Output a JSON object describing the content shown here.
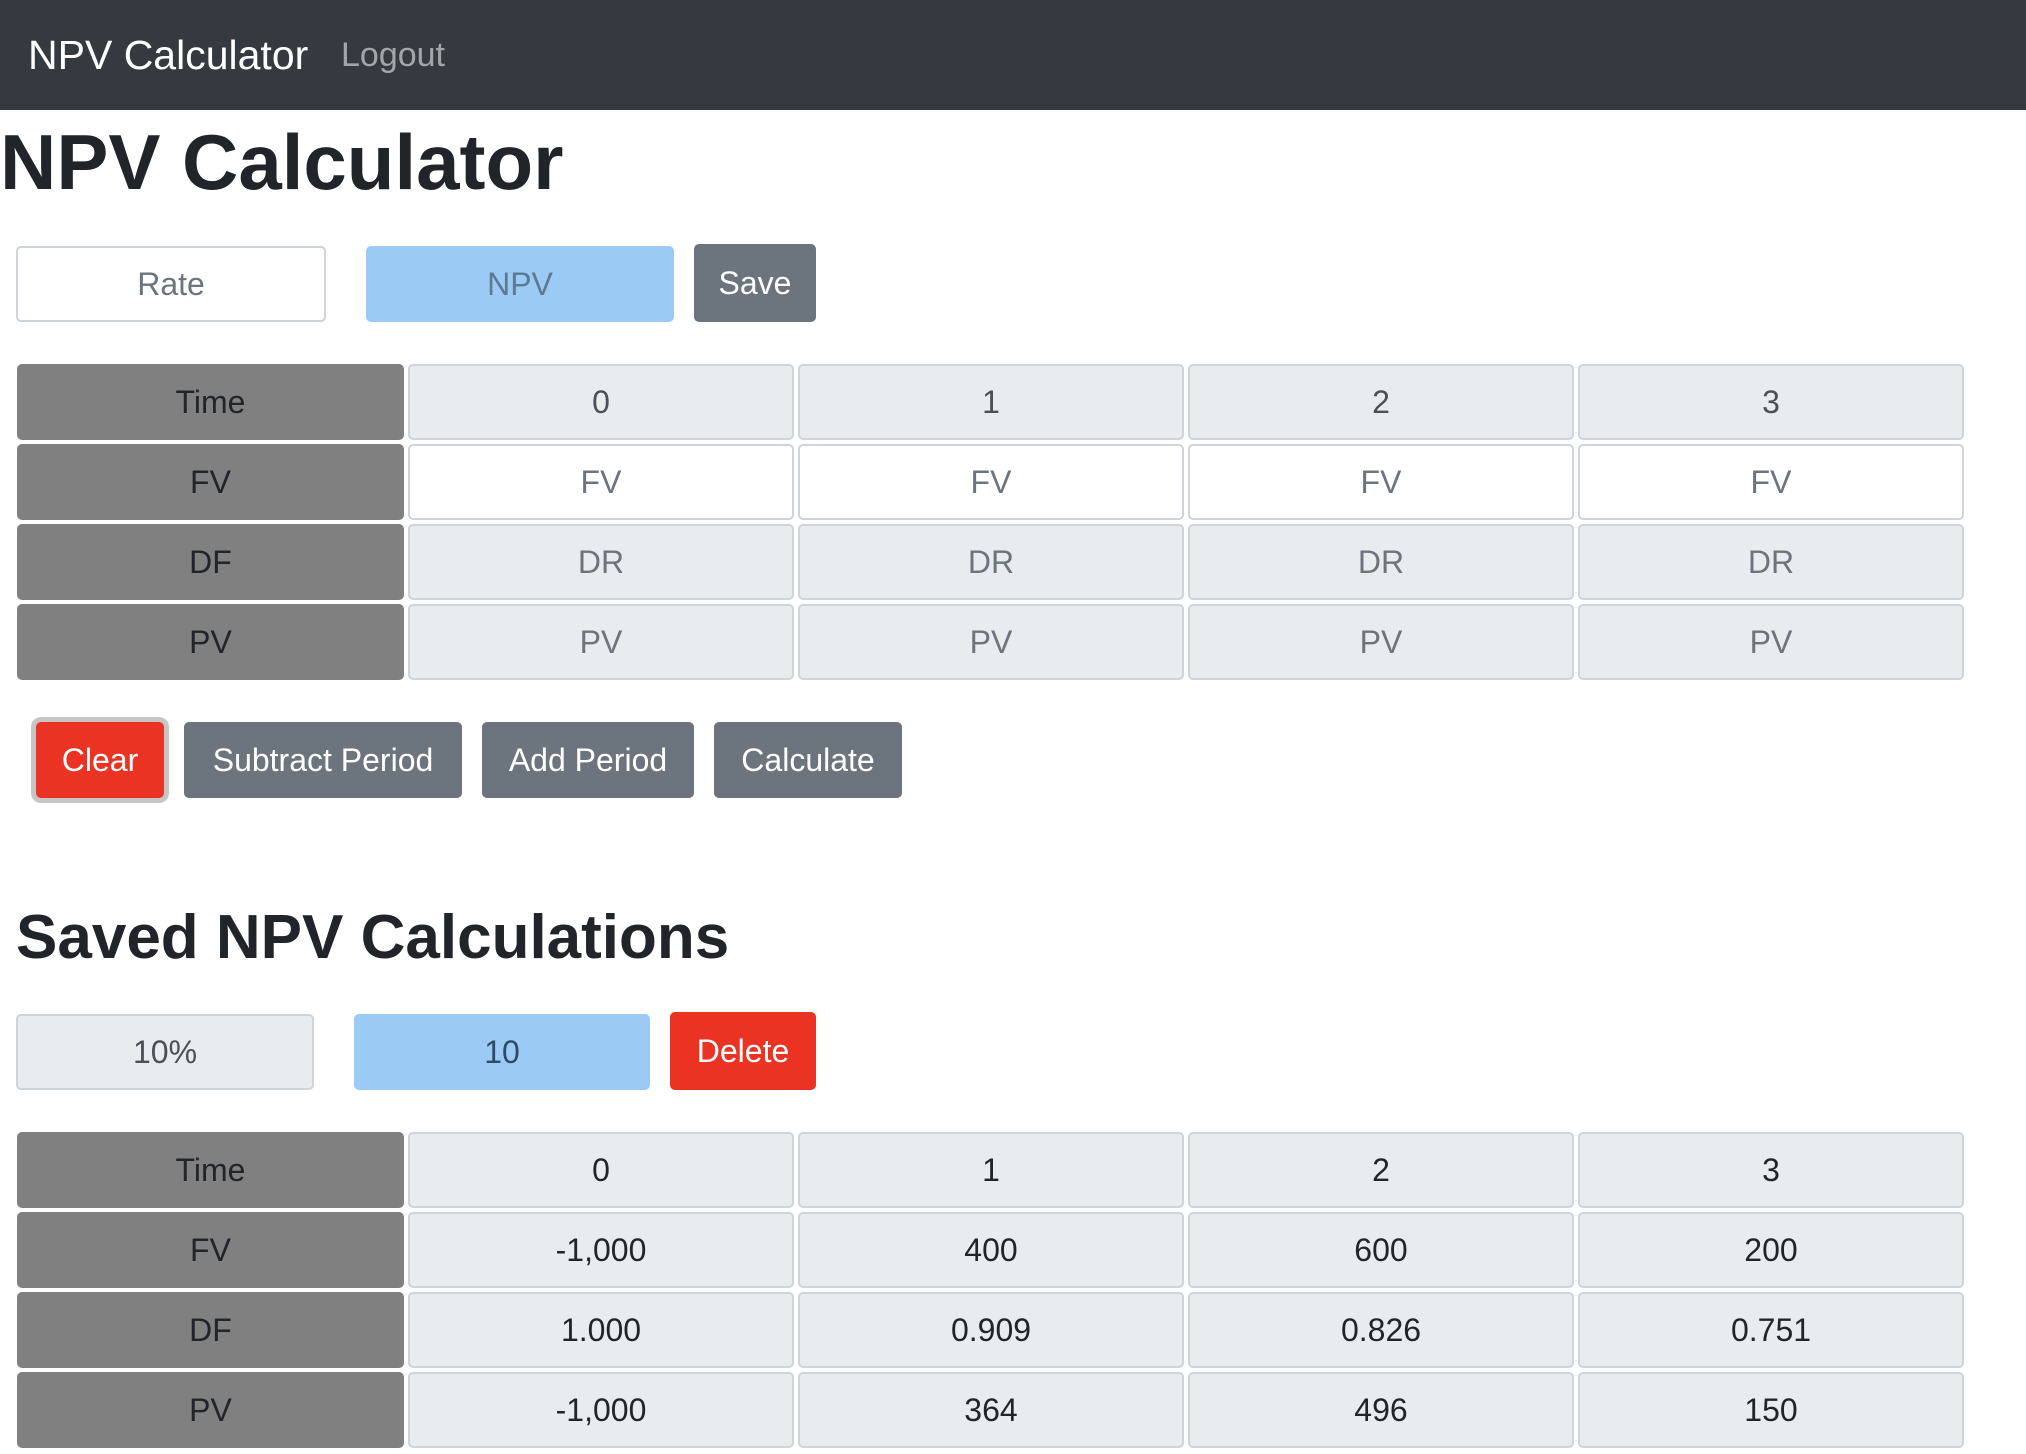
{
  "navbar": {
    "brand": "NPV Calculator",
    "logout": "Logout"
  },
  "calculator": {
    "title": "NPV Calculator",
    "rate_placeholder": "Rate",
    "npv_placeholder": "NPV",
    "save_label": "Save",
    "rows": {
      "time_label": "Time",
      "fv_label": "FV",
      "df_label": "DF",
      "pv_label": "PV"
    },
    "periods": [
      "0",
      "1",
      "2",
      "3"
    ],
    "fv_placeholders": [
      "FV",
      "FV",
      "FV",
      "FV"
    ],
    "df_placeholders": [
      "DR",
      "DR",
      "DR",
      "DR"
    ],
    "pv_placeholders": [
      "PV",
      "PV",
      "PV",
      "PV"
    ],
    "buttons": {
      "clear": "Clear",
      "subtract_period": "Subtract Period",
      "add_period": "Add Period",
      "calculate": "Calculate"
    }
  },
  "saved": {
    "title": "Saved NPV Calculations",
    "items": [
      {
        "rate": "10%",
        "npv": "10",
        "delete_label": "Delete",
        "time_label": "Time",
        "fv_label": "FV",
        "df_label": "DF",
        "pv_label": "PV",
        "periods": [
          "0",
          "1",
          "2",
          "3"
        ],
        "fv": [
          "-1,000",
          "400",
          "600",
          "200"
        ],
        "df": [
          "1.000",
          "0.909",
          "0.826",
          "0.751"
        ],
        "pv": [
          "-1,000",
          "364",
          "496",
          "150"
        ]
      }
    ]
  },
  "colors": {
    "navbar": "#343a40",
    "secondary_button": "#6c757d",
    "danger_button": "#ea3323",
    "npv_field": "#9bcbf5",
    "row_header": "#808080",
    "readonly_cell": "#e9ecef"
  }
}
